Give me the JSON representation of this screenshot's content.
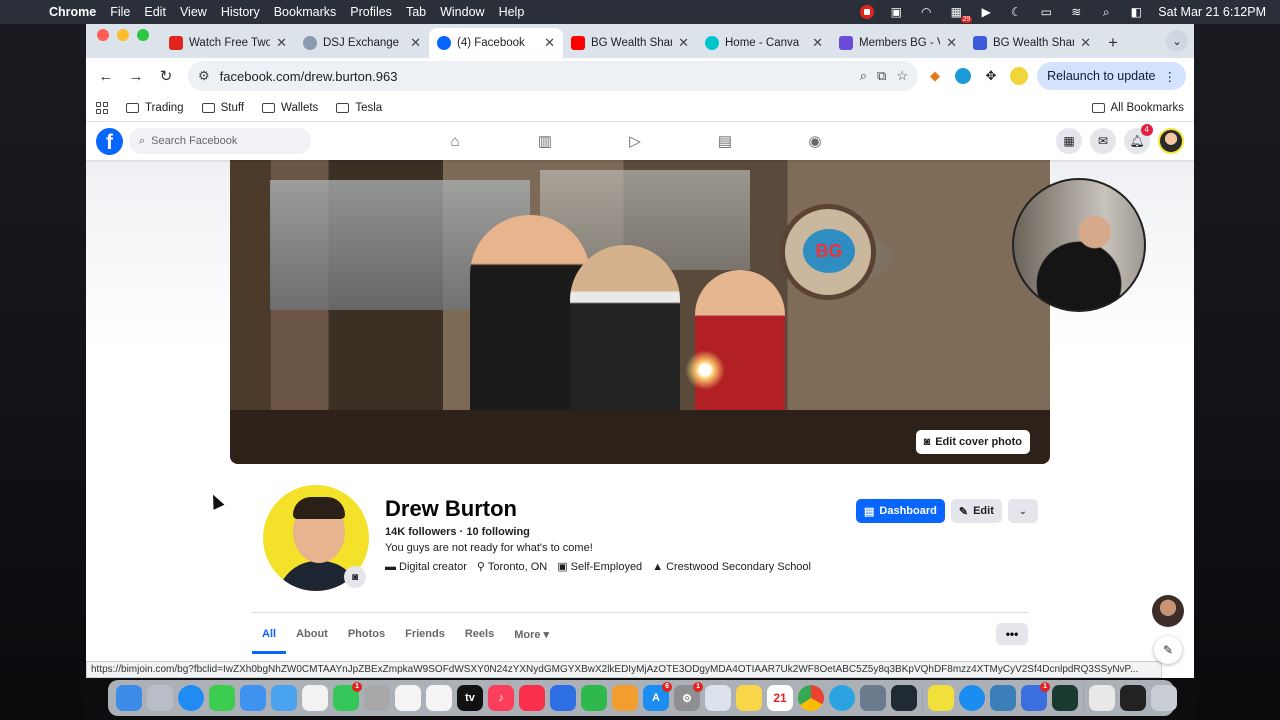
{
  "menubar": {
    "app": "Chrome",
    "items": [
      "File",
      "Edit",
      "View",
      "History",
      "Bookmarks",
      "Profiles",
      "Tab",
      "Window",
      "Help"
    ],
    "badge_count": "29",
    "datetime": "Sat Mar 21  6:12PM"
  },
  "tabs": [
    {
      "title": "Watch Free Two",
      "color": "#e0241f"
    },
    {
      "title": "DSJ Exchange",
      "color": "#8a9bb0"
    },
    {
      "title": "(4) Facebook",
      "color": "#0866ff",
      "active": true
    },
    {
      "title": "BG Wealth Shari",
      "color": "#ff0000"
    },
    {
      "title": "Home - Canva",
      "color": "#00c4cc"
    },
    {
      "title": "Members BG - V",
      "color": "#6a4cd8"
    },
    {
      "title": "BG Wealth Shari",
      "color": "#3b5bdb"
    }
  ],
  "toolbar": {
    "url": "facebook.com/drew.burton.963",
    "relaunch_label": "Relaunch to update"
  },
  "bookmarks": {
    "items": [
      "Trading",
      "Stuff",
      "Wallets",
      "Tesla"
    ],
    "all_label": "All Bookmarks"
  },
  "facebook": {
    "search_placeholder": "Search Facebook",
    "notifications_count": "4",
    "edit_cover_label": "Edit cover photo",
    "profile": {
      "name": "Drew Burton",
      "followers": "14K followers",
      "following": "10 following",
      "bio": "You guys are not ready for what's to come!",
      "category": "Digital creator",
      "location": "Toronto, ON",
      "work": "Self-Employed",
      "school": "Crestwood Secondary School"
    },
    "buttons": {
      "dashboard": "Dashboard",
      "edit": "Edit"
    },
    "tabs": [
      "All",
      "About",
      "Photos",
      "Friends",
      "Reels",
      "More"
    ],
    "cover_logo_text": "BG"
  },
  "status_url": "https://bimjoin.com/bg?fbclid=IwZXh0bgNhZW0CMTAAYnJpZBExZmpkaW9SOFdWSXY0N24zYXNydGMGYXBwX2lkEDIyMjAzOTE3ODgyMDA4OTIAAR7Uk2WF8OetABC5Z5y8q3BKpVQhDF8mzz4XTMyCyV2Sf4DcnlpdRQ3SSyNvP...",
  "dock": {
    "calendar_day": "21",
    "badges": {
      "messages": "1",
      "appstore": "6",
      "settings": "1",
      "cursor_app": "1"
    }
  }
}
